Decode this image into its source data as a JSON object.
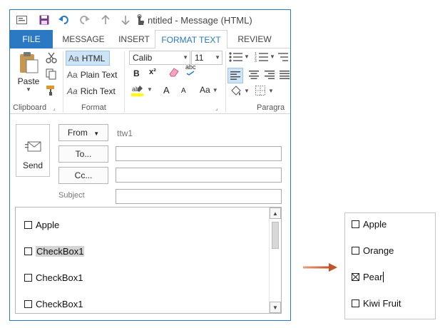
{
  "window": {
    "title": "ntitled - Message (HTML)"
  },
  "quick_access": [
    "mail-icon",
    "save-icon",
    "undo-icon",
    "redo-icon",
    "up-arrow-icon",
    "down-arrow-icon",
    "touch-icon"
  ],
  "tabs": [
    {
      "label": "FILE"
    },
    {
      "label": "MESSAGE"
    },
    {
      "label": "INSERT"
    },
    {
      "label": "FORMAT TEXT"
    },
    {
      "label": "REVIEW"
    }
  ],
  "ribbon": {
    "clipboard": {
      "label": "Clipboard",
      "paste": "Paste"
    },
    "format": {
      "label": "Format",
      "html": "HTML",
      "plain_text": "Plain Text",
      "rich_text": "Rich Text",
      "aa": "Aa"
    },
    "font": {
      "name": "Calib",
      "size": "11",
      "bold": "B",
      "superscript": "x²",
      "subscript_label": "abc",
      "grow": "A",
      "shrink": "A",
      "case": "Aa"
    },
    "paragraph": {
      "label": "Paragra"
    }
  },
  "header": {
    "send": "Send",
    "from": "From",
    "from_value": "ttw1",
    "to": "To...",
    "cc": "Cc...",
    "subject": "Subject"
  },
  "body_items": [
    {
      "label": "Apple",
      "checked": false,
      "highlight": false
    },
    {
      "label": "CheckBox1",
      "checked": false,
      "highlight": true
    },
    {
      "label": "CheckBox1",
      "checked": false,
      "highlight": false
    },
    {
      "label": "CheckBox1",
      "checked": false,
      "highlight": false
    }
  ],
  "result_items": [
    {
      "label": "Apple",
      "checked": false
    },
    {
      "label": "Orange",
      "checked": false
    },
    {
      "label": "Pear",
      "checked": true
    },
    {
      "label": "Kiwi Fruit",
      "checked": false
    }
  ],
  "colors": {
    "accent": "#2b79c2",
    "arrow": "#c0542a"
  }
}
